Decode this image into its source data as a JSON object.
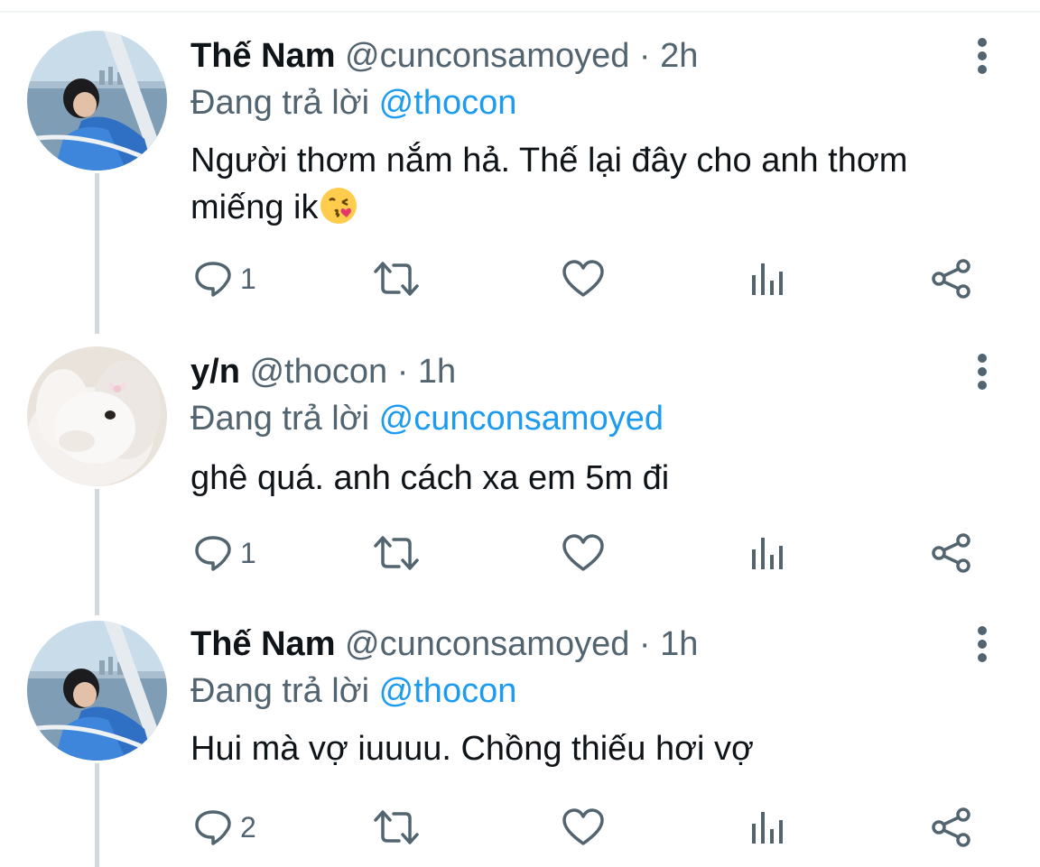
{
  "tweets": [
    {
      "display_name": "Thế Nam",
      "handle": "@cunconsamoyed",
      "separator": "·",
      "time": "2h",
      "replying_prefix": "Đang trả lời",
      "replying_to": "@thocon",
      "text": "Người thơm nắm hả. Thế lại đây cho anh thơm miếng ik",
      "emoji": "face-blowing-a-kiss",
      "reply_count": "1",
      "avatar": "person-by-water-avatar"
    },
    {
      "display_name": "y/n",
      "handle": "@thocon",
      "separator": "·",
      "time": "1h",
      "replying_prefix": "Đang trả lời",
      "replying_to": "@cunconsamoyed",
      "text": "ghê quá. anh cách xa em 5m đi",
      "emoji": "",
      "reply_count": "1",
      "avatar": "white-bunny-avatar"
    },
    {
      "display_name": "Thế Nam",
      "handle": "@cunconsamoyed",
      "separator": "·",
      "time": "1h",
      "replying_prefix": "Đang trả lời",
      "replying_to": "@thocon",
      "text": "Hui mà vợ iuuuu. Chồng thiếu hơi vợ",
      "emoji": "",
      "reply_count": "2",
      "avatar": "person-by-water-avatar"
    }
  ],
  "icons": {
    "reply": "reply-icon",
    "retweet": "retweet-icon",
    "like": "heart-icon",
    "analytics": "analytics-icon",
    "share": "share-icon",
    "more": "more-vertical-icon"
  },
  "colors": {
    "text": "#0f1419",
    "secondary": "#536471",
    "link": "#1d9bf0",
    "thread_line": "#cfd9de"
  }
}
